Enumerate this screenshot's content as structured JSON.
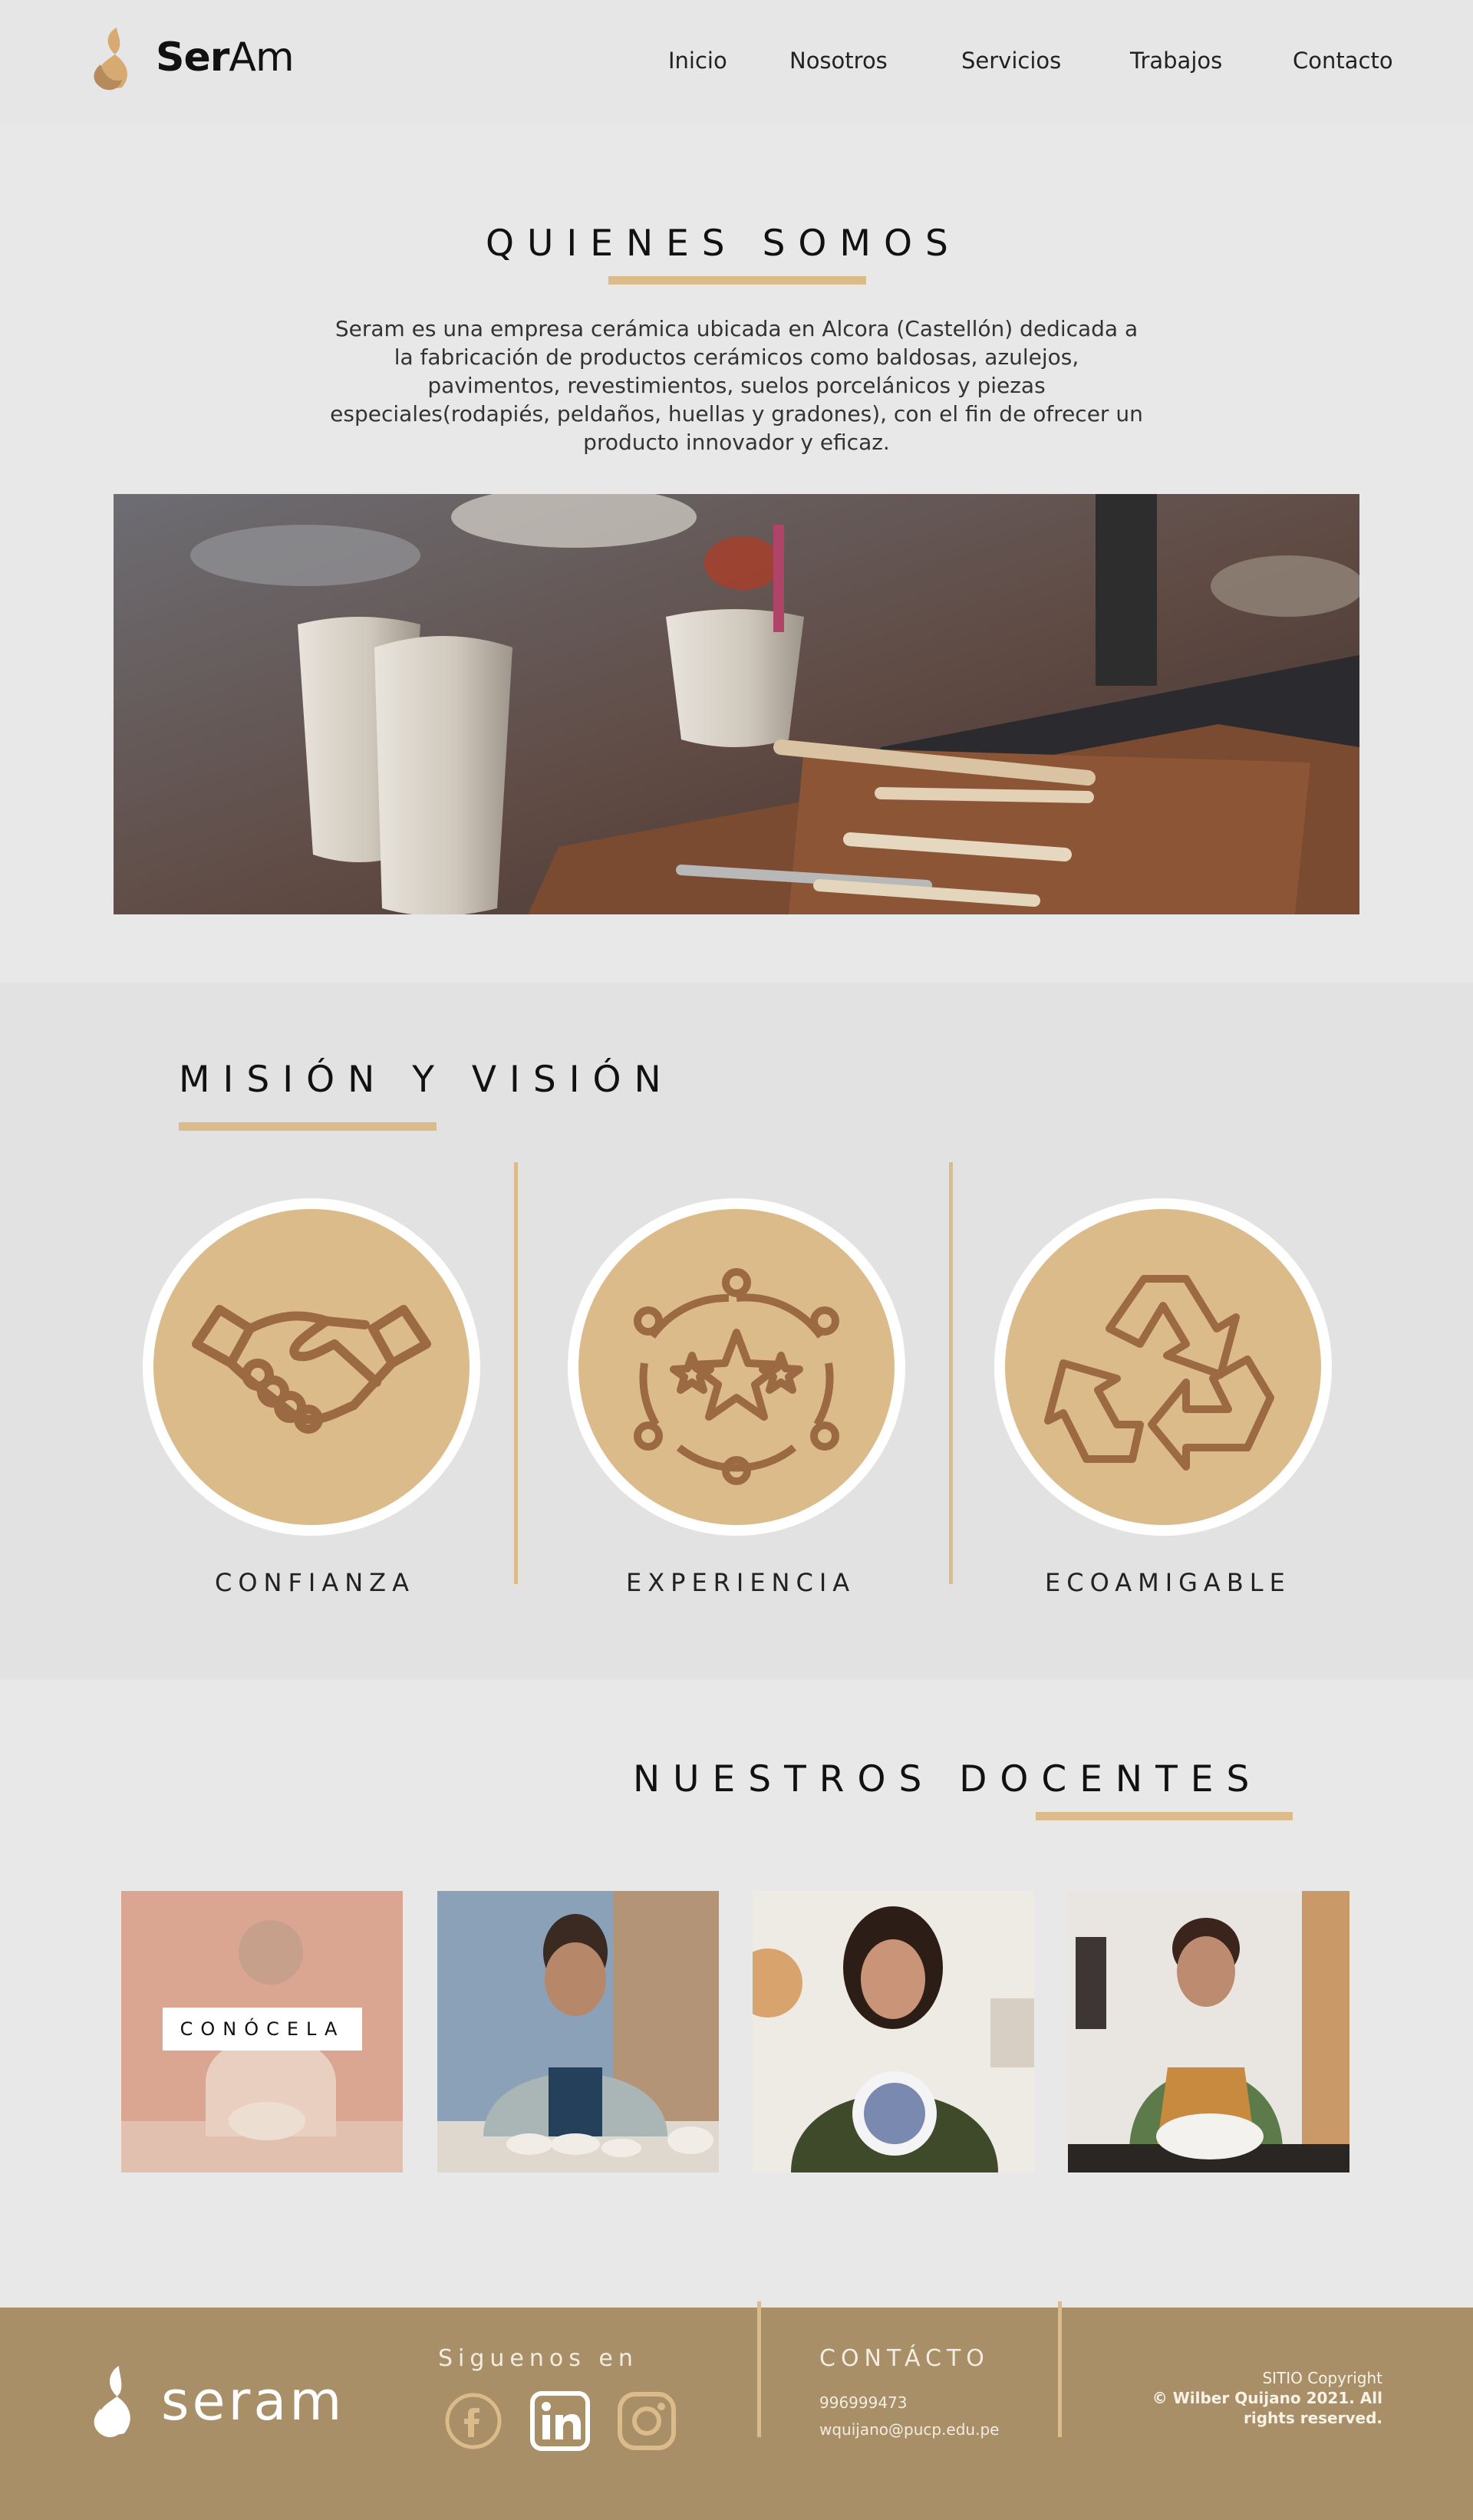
{
  "brand": {
    "name_bold": "Ser",
    "name_light": "Am"
  },
  "nav": {
    "items": [
      "Inicio",
      "Nosotros",
      "Servicios",
      "Trabajos",
      "Contacto"
    ]
  },
  "about": {
    "title": "QUIENES SOMOS",
    "text": "Seram es una empresa cerámica ubicada en Alcora (Castellón) dedicada a la fabricación de productos cerámicos como baldosas, azulejos, pavimentos, revestimientos, suelos porcelánicos y piezas especiales(rodapiés, peldaños, huellas y gradones), con el fin de ofrecer un producto innovador y eficaz."
  },
  "mission": {
    "title": "MISIÓN Y VISIÓN",
    "items": [
      {
        "label": "CONFIANZA",
        "icon": "handshake-icon"
      },
      {
        "label": "EXPERIENCIA",
        "icon": "stars-icon"
      },
      {
        "label": "ECOAMIGABLE",
        "icon": "recycle-icon"
      }
    ]
  },
  "team": {
    "title": "NUESTROS DOCENTES",
    "badge": "CONÓCELA"
  },
  "footer": {
    "brand": "seram",
    "follow": "Siguenos en",
    "contact_title": "CONTÁCTO",
    "phone": "996999473",
    "email": "wquijano@pucp.edu.pe",
    "copyright1": "SITIO Copyright",
    "copyright2": "© Wilber Quijano 2021. All rights reserved."
  },
  "colors": {
    "accent": "#dcbb8b",
    "footer": "#a88f67",
    "icon": "#9b6a43"
  }
}
